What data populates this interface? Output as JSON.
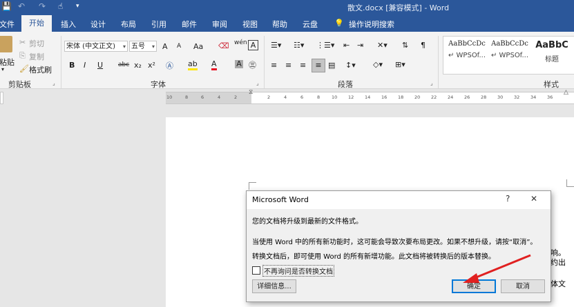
{
  "titlebar": {
    "title": "散文.docx [兼容模式] - Word",
    "save_icon": "💾",
    "undo_icon": "↶",
    "redo_icon": "↷",
    "touch_icon": "☝",
    "customize_icon": "▾",
    "bg": "#2b579a"
  },
  "tabs": [
    {
      "label": "文件"
    },
    {
      "label": "开始"
    },
    {
      "label": "插入"
    },
    {
      "label": "设计"
    },
    {
      "label": "布局"
    },
    {
      "label": "引用"
    },
    {
      "label": "邮件"
    },
    {
      "label": "审阅"
    },
    {
      "label": "视图"
    },
    {
      "label": "帮助"
    },
    {
      "label": "云盘"
    }
  ],
  "tell_me": {
    "icon": "💡",
    "label": "操作说明搜索"
  },
  "clipboard": {
    "paste": "粘贴",
    "cut": "剪切",
    "copy": "复制",
    "format_painter": "格式刷",
    "group_label": "剪贴板"
  },
  "font": {
    "font_name": "宋体 (中文正文)",
    "font_size": "五号",
    "grow": "A",
    "shrink": "A",
    "case": "Aa",
    "bold": "B",
    "italic": "I",
    "underline": "U",
    "strike": "abc",
    "subscript": "x₂",
    "superscript": "x²",
    "group_label": "字体"
  },
  "paragraph": {
    "group_label": "段落"
  },
  "styles": {
    "items": [
      {
        "preview": "AaBbCcDc",
        "name": "WPSOf..."
      },
      {
        "preview": "AaBbCcDc",
        "name": "WPSOf..."
      },
      {
        "preview": "AaBbC",
        "name": "标题"
      }
    ],
    "group_label": "样式"
  },
  "ruler": {
    "left_ticks": [
      "10",
      "8",
      "6",
      "4",
      "2"
    ],
    "right_ticks": [
      "2",
      "4",
      "6",
      "8",
      "10",
      "12",
      "14",
      "16",
      "18",
      "20",
      "22",
      "24",
      "26",
      "28",
      "30",
      "32",
      "34",
      "36"
    ]
  },
  "dialog": {
    "title": "Microsoft Word",
    "help": "?",
    "close": "✕",
    "line1": "您的文档将升级到最新的文件格式。",
    "line2": "当使用 Word 中的所有新功能时，这可能会导致次要布局更改。如果不想升级，请按“取消”。",
    "line3": "转换文档后，即可使用 Word 的所有新增功能。此文档将被转换后的版本替换。",
    "checkbox_label": "不再询问是否转换文档",
    "details_button": "详细信息...",
    "ok_button": "确定",
    "cancel_button": "取消"
  },
  "doc_fragments": [
    "响。",
    "约出",
    "体文"
  ]
}
